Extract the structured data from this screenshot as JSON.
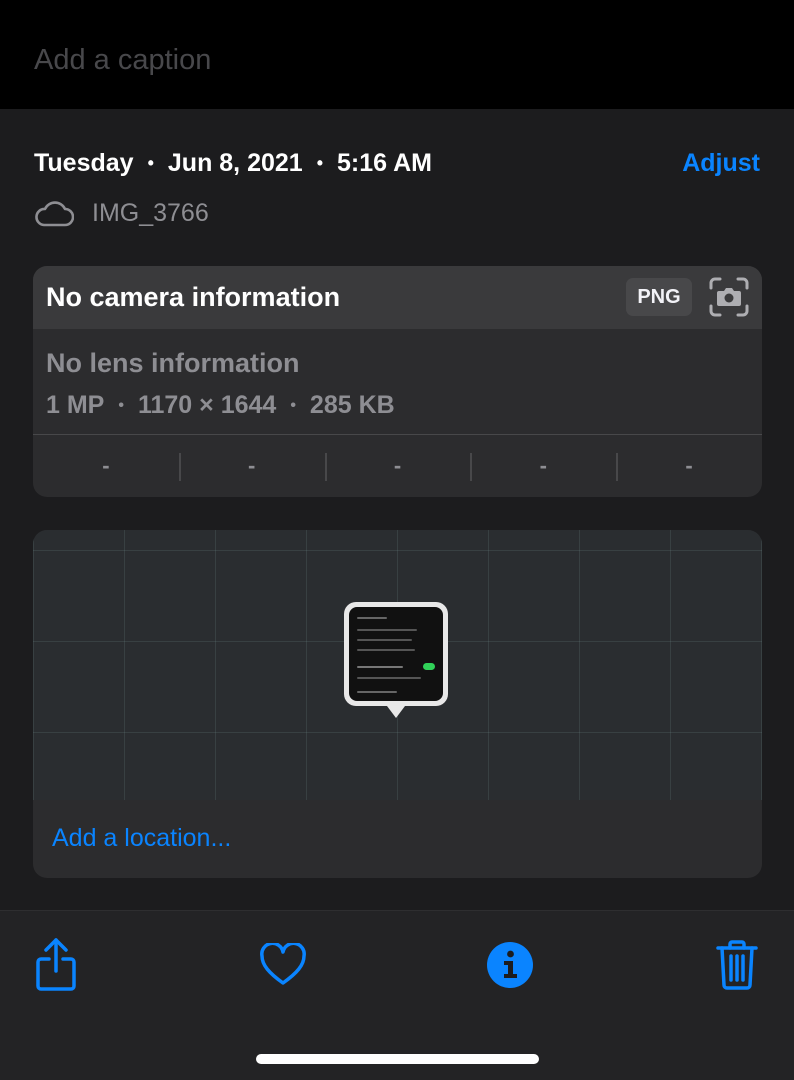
{
  "caption": {
    "placeholder": "Add a caption"
  },
  "meta": {
    "day": "Tuesday",
    "date": "Jun 8, 2021",
    "time": "5:16 AM",
    "adjust_label": "Adjust",
    "file_name": "IMG_3766",
    "cloud_icon": "cloud-icon"
  },
  "camera_card": {
    "camera": "No camera information",
    "format": "PNG",
    "lens": "No lens information",
    "megapixels": "1 MP",
    "dimensions": "1170 × 1644",
    "file_size": "285 KB",
    "exif": [
      "-",
      "-",
      "-",
      "-",
      "-"
    ]
  },
  "map": {
    "add_location_label": "Add a location..."
  },
  "toolbar": {
    "share_icon": "share-icon",
    "favorite_icon": "heart-icon",
    "info_icon": "info-icon",
    "delete_icon": "trash-icon"
  },
  "colors": {
    "accent": "#0a84ff",
    "background": "#1c1c1e",
    "card": "#2c2c2e",
    "secondary_text": "#8e8e93"
  }
}
